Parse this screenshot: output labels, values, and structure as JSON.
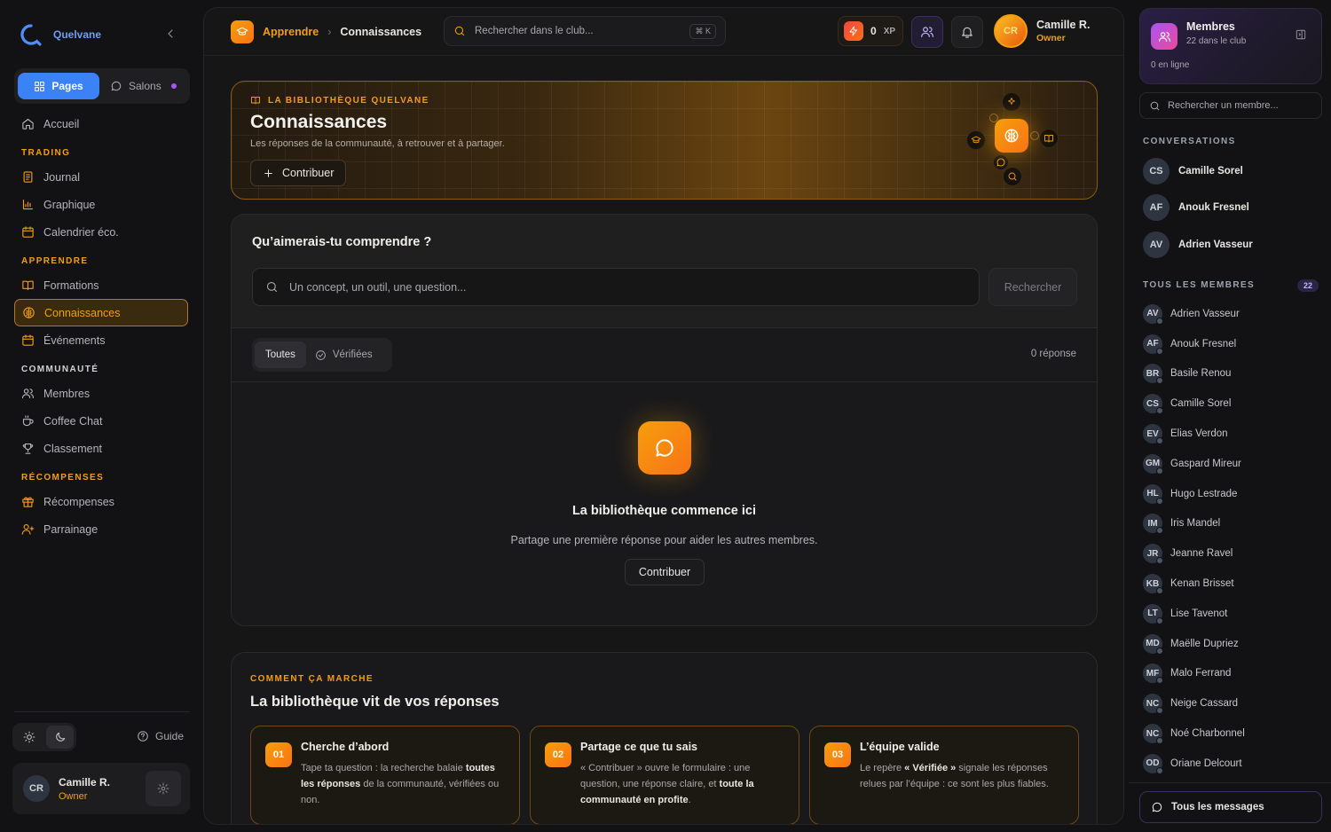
{
  "brand": {
    "name": "Quelvane"
  },
  "sidebar": {
    "tabs": {
      "pages": "Pages",
      "salons": "Salons"
    },
    "home": "Accueil",
    "sections": [
      {
        "title": "TRADING",
        "items": [
          "Journal",
          "Graphique",
          "Calendrier éco."
        ]
      },
      {
        "title": "APPRENDRE",
        "items": [
          "Formations",
          "Connaissances",
          "Événements"
        ]
      },
      {
        "title": "COMMUNAUTÉ",
        "items": [
          "Membres",
          "Coffee Chat",
          "Classement"
        ]
      },
      {
        "title": "RÉCOMPENSES",
        "items": [
          "Récompenses",
          "Parrainage"
        ]
      }
    ],
    "active_item": "Connaissances",
    "guide": "Guide",
    "user": {
      "initials": "CR",
      "name": "Camille R.",
      "role": "Owner"
    }
  },
  "topbar": {
    "breadcrumb": [
      "Apprendre",
      "Connaissances"
    ],
    "search_placeholder": "Rechercher dans le club...",
    "shortcut": "⌘ K",
    "xp_value": "0",
    "xp_label": "XP",
    "user": {
      "initials": "CR",
      "name": "Camille R.",
      "role": "Owner"
    }
  },
  "hero": {
    "eyebrow": "LA BIBLIOTHÈQUE QUELVANE",
    "title": "Connaissances",
    "subtitle": "Les réponses de la communauté, à retrouver et à partager.",
    "button": "Contribuer"
  },
  "question": {
    "title": "Qu’aimerais-tu comprendre ?",
    "placeholder": "Un concept, un outil, une question...",
    "search_button": "Rechercher",
    "filters": [
      "Toutes",
      "Vérifiées"
    ],
    "count": "0 réponse",
    "empty_title": "La bibliothèque commence ici",
    "empty_sub": "Partage une première réponse pour aider les autres membres.",
    "empty_button": "Contribuer"
  },
  "how": {
    "eyebrow": "COMMENT ÇA MARCHE",
    "title": "La bibliothèque vit de vos réponses",
    "steps": [
      {
        "num": "01",
        "title": "Cherche d’abord"
      },
      {
        "num": "02",
        "title": "Partage ce que tu sais"
      },
      {
        "num": "03",
        "title": "L’équipe valide"
      }
    ]
  },
  "right": {
    "title": "Membres",
    "subtitle": "22 dans le club",
    "online": "0 en ligne",
    "search_placeholder": "Rechercher un membre...",
    "conversations_title": "CONVERSATIONS",
    "conversations": [
      {
        "initials": "CS",
        "name": "Camille Sorel"
      },
      {
        "initials": "AF",
        "name": "Anouk Fresnel"
      },
      {
        "initials": "AV",
        "name": "Adrien Vasseur"
      }
    ],
    "members_title": "TOUS LES MEMBRES",
    "members_count": "22",
    "members": [
      {
        "initials": "AV",
        "name": "Adrien Vasseur"
      },
      {
        "initials": "AF",
        "name": "Anouk Fresnel"
      },
      {
        "initials": "BR",
        "name": "Basile Renou"
      },
      {
        "initials": "CS",
        "name": "Camille Sorel"
      },
      {
        "initials": "EV",
        "name": "Elias Verdon"
      },
      {
        "initials": "GM",
        "name": "Gaspard Mireur"
      },
      {
        "initials": "HL",
        "name": "Hugo Lestrade"
      },
      {
        "initials": "IM",
        "name": "Iris Mandel"
      },
      {
        "initials": "JR",
        "name": "Jeanne Ravel"
      },
      {
        "initials": "KB",
        "name": "Kenan Brisset"
      },
      {
        "initials": "LT",
        "name": "Lise Tavenot"
      },
      {
        "initials": "MD",
        "name": "Maëlle Dupriez"
      },
      {
        "initials": "MF",
        "name": "Malo Ferrand"
      },
      {
        "initials": "NC",
        "name": "Neige Cassard"
      },
      {
        "initials": "NC",
        "name": "Noé Charbonnel"
      },
      {
        "initials": "OD",
        "name": "Oriane Delcourt"
      }
    ],
    "all_messages": "Tous les messages"
  },
  "colors": {
    "accent": "#f59e0b",
    "primary": "#3b82f6",
    "purple": "#a855f7"
  }
}
